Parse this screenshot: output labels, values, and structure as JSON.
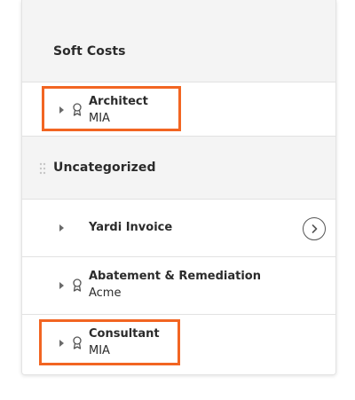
{
  "groups": [
    {
      "title": "Soft Costs",
      "items": [
        {
          "title": "Architect",
          "subtitle": "MIA",
          "icon": "ribbon-icon",
          "highlighted": true
        }
      ]
    },
    {
      "title": "Uncategorized",
      "items": [
        {
          "title": "Yardi Invoice",
          "subtitle": "",
          "icon": "",
          "action": "chevron-right-icon"
        },
        {
          "title": "Abatement & Remediation",
          "subtitle": "Acme",
          "icon": "ribbon-icon"
        },
        {
          "title": "Consultant",
          "subtitle": "MIA",
          "icon": "ribbon-icon",
          "highlighted": true
        }
      ]
    }
  ],
  "colors": {
    "highlight": "#f26522",
    "header_bg": "#f4f4f4",
    "text": "#2b2b2b",
    "divider": "#e2e2e2"
  }
}
